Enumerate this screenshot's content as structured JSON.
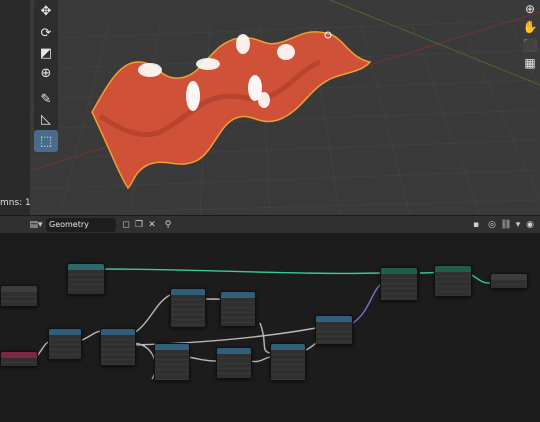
{
  "viewport": {
    "columns_label": "mns: 1",
    "tools": [
      {
        "name": "move-icon",
        "glyph": "✥"
      },
      {
        "name": "rotate-icon",
        "glyph": "⟳"
      },
      {
        "name": "scale-icon",
        "glyph": "◩"
      },
      {
        "name": "transform-icon",
        "glyph": "⊕"
      },
      {
        "name": "annotate-icon",
        "glyph": "✎"
      },
      {
        "name": "measure-icon",
        "glyph": "◺"
      },
      {
        "name": "add-cube-icon",
        "glyph": "⬚"
      }
    ],
    "right_icons": [
      {
        "name": "zoom-icon",
        "glyph": "⊕"
      },
      {
        "name": "pan-hand-icon",
        "glyph": "✋"
      },
      {
        "name": "camera-icon",
        "glyph": "⬛"
      },
      {
        "name": "grid-icon",
        "glyph": "▦"
      }
    ],
    "colors": {
      "background": "#3a3a3a",
      "grid": "#444444",
      "mesh": "#d2553a",
      "selection_outline": "#f0a030"
    }
  },
  "node_editor": {
    "header": {
      "editor_type_icon": "node-editor-icon",
      "tree_name": "Geometry Nodes",
      "icons": [
        "shield-icon",
        "copy-icon",
        "close-icon",
        "pin-icon"
      ],
      "right_icons": [
        "overlay-icon",
        "snap-icon",
        "link-icon",
        "dropdown-icon",
        "settings-icon"
      ]
    },
    "colors": {
      "background": "#1c1c1c",
      "link_green": "#39c9a0",
      "link_gray": "#b8b8b8",
      "link_purple": "#7b6fd0"
    }
  }
}
